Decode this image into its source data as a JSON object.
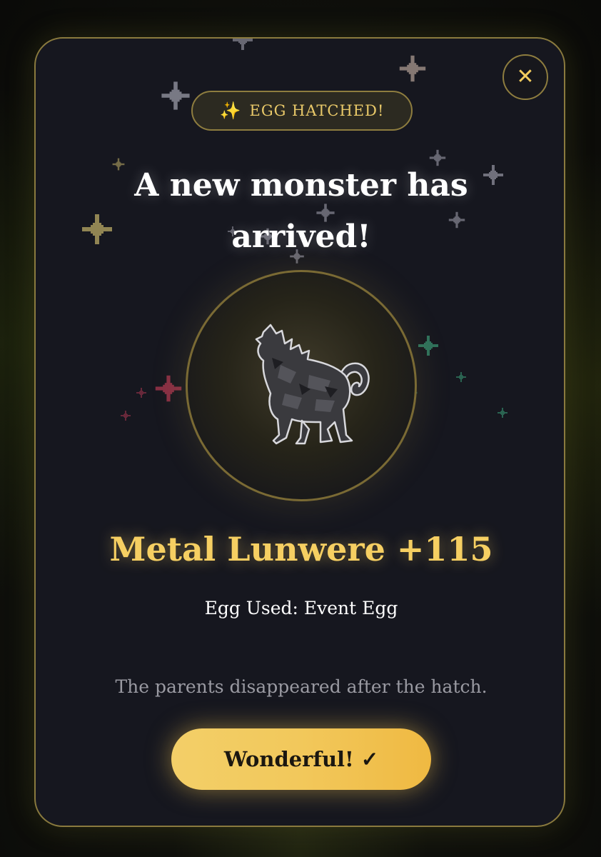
{
  "badge": {
    "icon": "sparkles-icon",
    "label": "EGG HATCHED!"
  },
  "headline": {
    "line1": "A new monster has",
    "line2": "arrived!"
  },
  "monster": {
    "name": "Metal Lunwere +115",
    "sprite": "howling-wolf-sprite"
  },
  "egg_used": "Egg Used: Event Egg",
  "note": "The parents disappeared after the hatch.",
  "confirm_button": {
    "label": "Wonderful! ✓"
  },
  "close_button": {
    "icon": "close-icon",
    "glyph": "✕"
  },
  "colors": {
    "accent": "#f6cf62",
    "border": "#8a7a3e",
    "panel": "#16171f",
    "button": "#f2c85b"
  }
}
